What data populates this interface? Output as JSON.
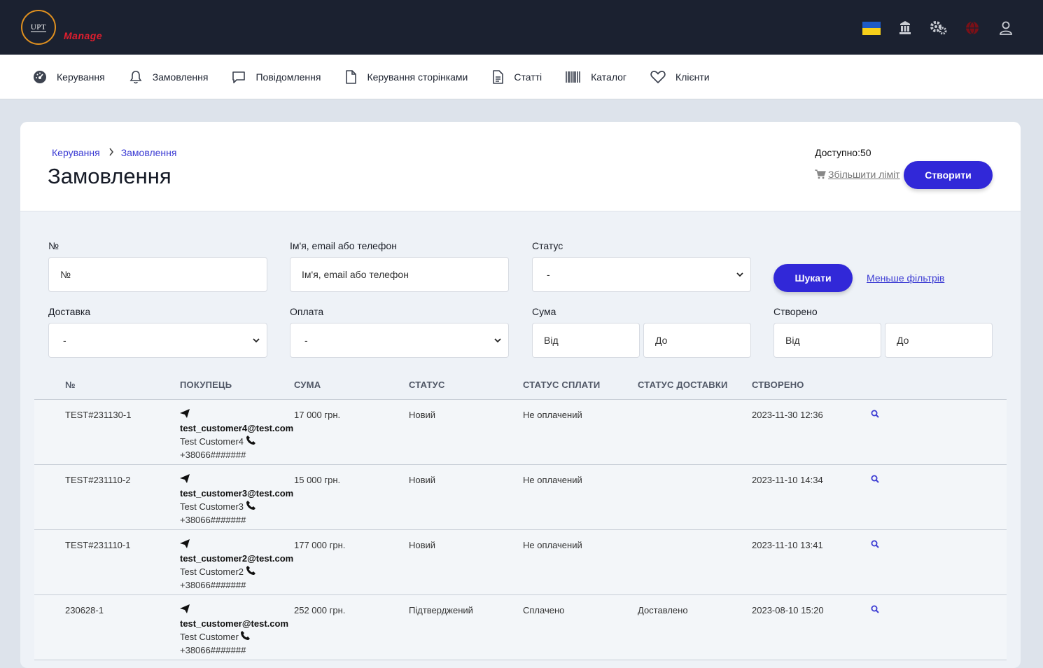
{
  "brand": {
    "logo_text": "UPT",
    "subtitle": "Manage"
  },
  "topbar": {
    "icons": [
      "ukraine-flag-icon",
      "building-icon",
      "gears-icon",
      "globe-icon",
      "user-icon"
    ]
  },
  "nav": {
    "items": [
      {
        "label": "Керування",
        "icon": "dashboard-icon"
      },
      {
        "label": "Замовлення",
        "icon": "bell-icon"
      },
      {
        "label": "Повідомлення",
        "icon": "message-icon"
      },
      {
        "label": "Керування сторінками",
        "icon": "file-icon"
      },
      {
        "label": "Статті",
        "icon": "document-icon"
      },
      {
        "label": "Каталог",
        "icon": "barcode-icon"
      },
      {
        "label": "Клієнти",
        "icon": "heart-icon"
      }
    ]
  },
  "breadcrumb": {
    "root": "Керування",
    "current": "Замовлення"
  },
  "page": {
    "title": "Замовлення",
    "available": "Доступно:50",
    "increase_limit": "Збільшити ліміт",
    "create_label": "Створити"
  },
  "filters": {
    "number_label": "№",
    "number_placeholder": "№",
    "name_label": "Ім'я, email або телефон",
    "name_placeholder": "Ім'я, email або телефон",
    "status_label": "Статус",
    "status_value": "-",
    "search_label": "Шукати",
    "less_filters": "Меньше фільтрів",
    "delivery_label": "Доставка",
    "delivery_value": "-",
    "payment_label": "Оплата",
    "payment_value": "-",
    "sum_label": "Сума",
    "sum_from": "Від",
    "sum_to": "До",
    "created_label": "Створено",
    "created_from": "Від",
    "created_to": "До"
  },
  "table": {
    "headers": [
      "№",
      "ПОКУПЕЦЬ",
      "СУМА",
      "СТАТУС",
      "СТАТУС СПЛАТИ",
      "СТАТУС ДОСТАВКИ",
      "СТВОРЕНО"
    ],
    "rows": [
      {
        "number": "TEST#231130-1",
        "email": "test_customer4@test.com",
        "name": "Test Customer4",
        "phone": "+38066#######",
        "sum": "17 000 грн.",
        "status": "Новий",
        "payment": "Не оплачений",
        "delivery": "",
        "created": "2023-11-30 12:36"
      },
      {
        "number": "TEST#231110-2",
        "email": "test_customer3@test.com",
        "name": "Test Customer3",
        "phone": "+38066#######",
        "sum": "15 000 грн.",
        "status": "Новий",
        "payment": "Не оплачений",
        "delivery": "",
        "created": "2023-11-10 14:34"
      },
      {
        "number": "TEST#231110-1",
        "email": "test_customer2@test.com",
        "name": "Test Customer2",
        "phone": "+38066#######",
        "sum": "177 000 грн.",
        "status": "Новий",
        "payment": "Не оплачений",
        "delivery": "",
        "created": "2023-11-10 13:41"
      },
      {
        "number": "230628-1",
        "email": "test_customer@test.com",
        "name": "Test Customer",
        "phone": "+38066#######",
        "sum": "252 000 грн.",
        "status": "Підтверджений",
        "payment": "Сплачено",
        "delivery": "Доставлено",
        "created": "2023-08-10 15:20"
      }
    ]
  },
  "colors": {
    "topbar": "#1b2130",
    "accent": "#3128d8",
    "link": "#3b3bd3",
    "brand_red": "#e01e2e",
    "logo_ring": "#e0901f"
  }
}
